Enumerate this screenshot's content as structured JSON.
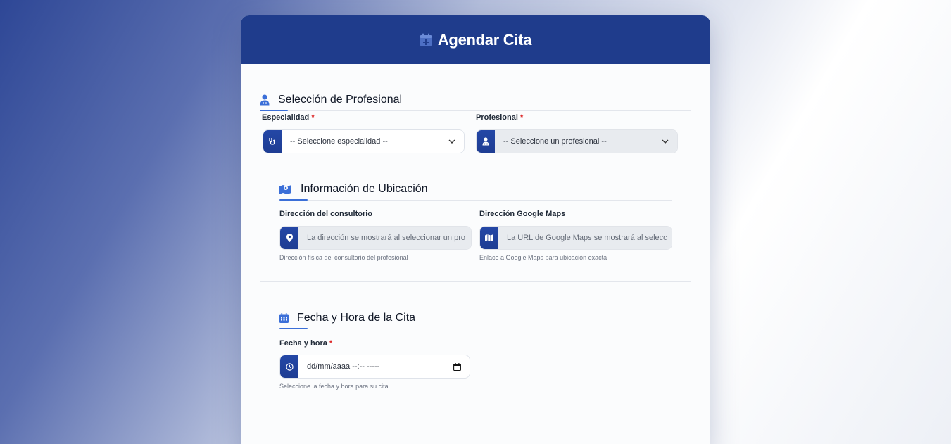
{
  "header": {
    "title": "Agendar Cita",
    "icon": "calendar-plus-icon"
  },
  "sections": {
    "profesional": {
      "title": "Selección de Profesional",
      "icon": "user-doctor-icon",
      "especialidad": {
        "label": "Especialidad",
        "required_mark": "*",
        "value": "-- Seleccione especialidad --",
        "icon": "stethoscope-icon"
      },
      "profesional": {
        "label": "Profesional",
        "required_mark": "*",
        "value": "-- Seleccione un profesional --",
        "icon": "user-doctor-icon"
      }
    },
    "ubicacion": {
      "title": "Información de Ubicación",
      "icon": "map-location-icon",
      "direccion": {
        "label": "Dirección del consultorio",
        "placeholder": "La dirección se mostrará al seleccionar un pro",
        "hint": "Dirección física del consultorio del profesional",
        "icon": "map-pin-icon"
      },
      "maps": {
        "label": "Dirección Google Maps",
        "placeholder": "La URL de Google Maps se mostrará al selecc",
        "hint": "Enlace a Google Maps para ubicación exacta",
        "icon": "map-icon"
      }
    },
    "fecha": {
      "title": "Fecha y Hora de la Cita",
      "icon": "calendar-icon",
      "fecha_hora": {
        "label": "Fecha y hora",
        "required_mark": "*",
        "value": "dd/mm/aaaa --:-- -----",
        "hint": "Seleccione la fecha y hora para su cita",
        "icon": "clock-icon"
      }
    }
  },
  "colors": {
    "header_bg": "#1f3c8c",
    "accent": "#3b6fd8",
    "required": "#dc2626"
  }
}
